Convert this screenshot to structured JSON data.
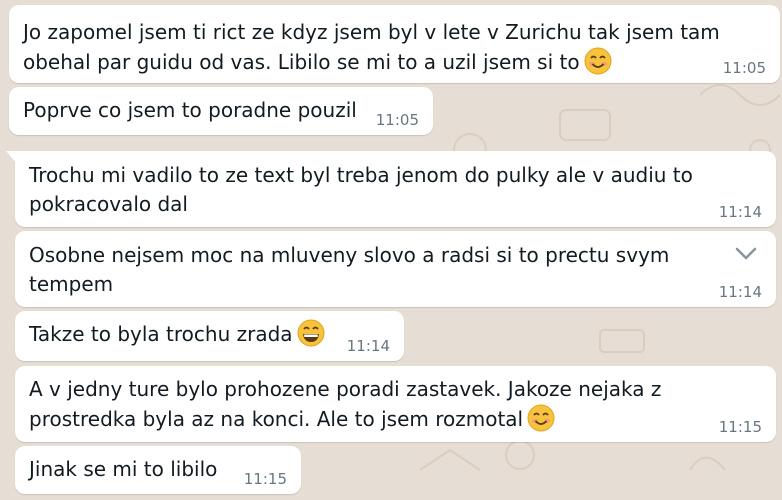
{
  "chat": {
    "background": "#e6ddd4",
    "messages": [
      {
        "text": "Jo zapomel jsem ti rict ze kdyz jsem byl v lete v Zurichu tak jsem tam obehal par guidu od vas. Libilo se mi to a uzil jsem si to",
        "time": "11:05",
        "emoji": "smiling-face-icon"
      },
      {
        "text": "Poprve co jsem to poradne pouzil",
        "time": "11:05"
      },
      {
        "text": "Trochu mi vadilo to ze text byl treba jenom do pulky ale v audiu to pokracovalo dal",
        "time": "11:14"
      },
      {
        "text": "Osobne nejsem moc na mluveny slovo a radsi si to prectu svym tempem",
        "time": "11:14",
        "menu_icon": "chevron-down-icon"
      },
      {
        "text": "Takze to byla trochu zrada",
        "time": "11:14",
        "emoji": "grinning-face-icon"
      },
      {
        "text": "A v jedny ture bylo prohozene poradi zastavek. Jakoze nejaka z prostredka byla az na konci. Ale to jsem rozmotal",
        "time": "11:15",
        "emoji": "smiling-face-icon"
      },
      {
        "text": "Jinak se mi to libilo",
        "time": "11:15"
      }
    ]
  }
}
